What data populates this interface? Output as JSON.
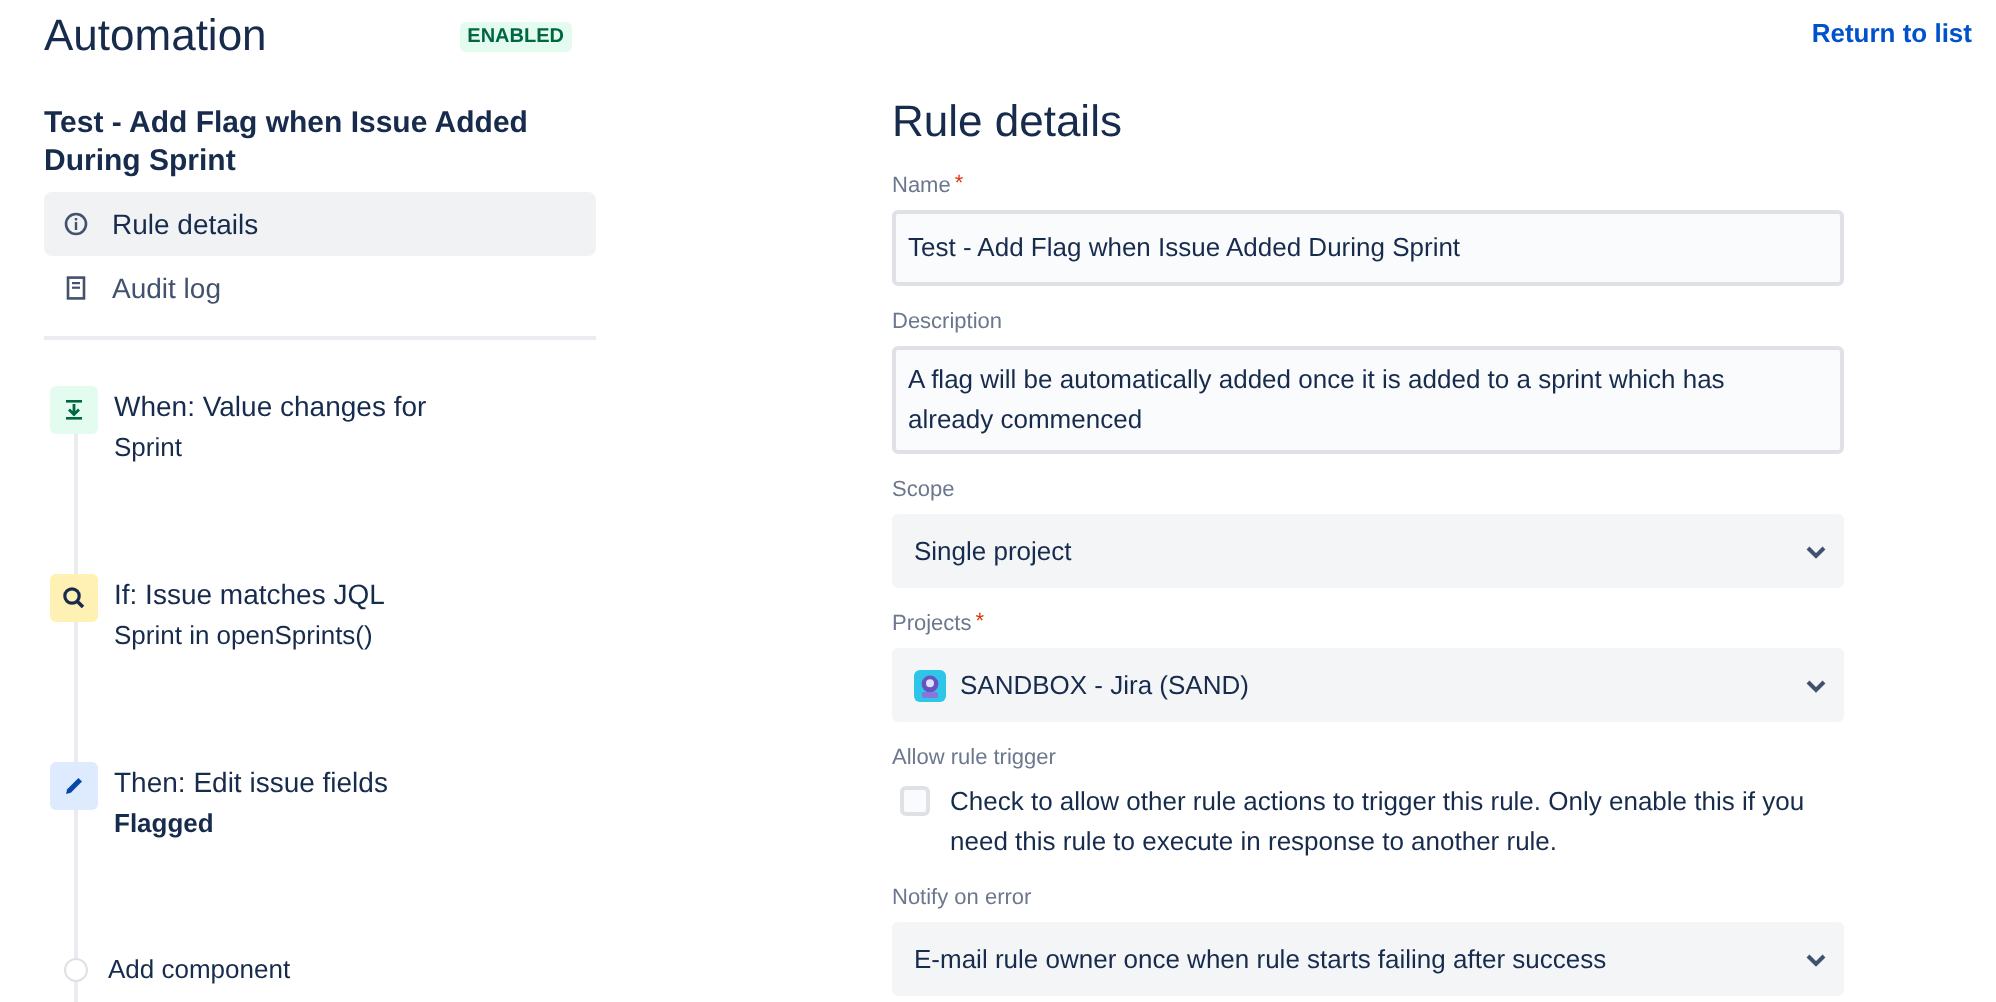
{
  "header": {
    "title": "Automation",
    "status_badge": "ENABLED",
    "return_link": "Return to list"
  },
  "rule_title": "Test - Add Flag when Issue Added During Sprint",
  "nav": [
    {
      "label": "Rule details",
      "kind": "info",
      "selected": true
    },
    {
      "label": "Audit log",
      "kind": "log",
      "selected": false
    }
  ],
  "components": [
    {
      "kind": "trigger",
      "title": "When: Value changes for",
      "detail": "Sprint",
      "emphasis": false
    },
    {
      "kind": "condition",
      "title": "If: Issue matches JQL",
      "detail": "Sprint in openSprints()",
      "emphasis": false
    },
    {
      "kind": "action",
      "title": "Then: Edit issue fields",
      "detail": "Flagged",
      "emphasis": true
    },
    {
      "kind": "add",
      "title": "Add component"
    }
  ],
  "form": {
    "heading": "Rule details",
    "fields": [
      {
        "kind": "text",
        "label": "Name",
        "required_mark": "*",
        "value": "Test - Add Flag when Issue Added During Sprint"
      },
      {
        "kind": "textarea",
        "label": "Description",
        "value": "A flag will be automatically added once it is added to a sprint which has already commenced"
      },
      {
        "kind": "select",
        "label": "Scope",
        "value": "Single project"
      },
      {
        "kind": "project",
        "label": "Projects",
        "required_mark": "*",
        "value": "SANDBOX - Jira (SAND)"
      },
      {
        "kind": "checkbox",
        "label": "Allow rule trigger",
        "text": "Check to allow other rule actions to trigger this rule. Only enable this if you need this rule to execute in response to another rule.",
        "checked": false
      },
      {
        "kind": "select",
        "label": "Notify on error",
        "value": "E-mail rule owner once when rule starts failing after success"
      }
    ]
  }
}
